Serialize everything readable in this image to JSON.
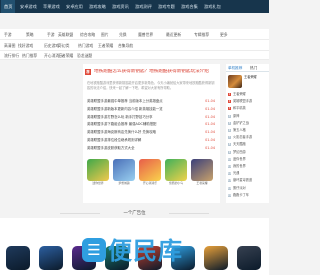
{
  "nav": {
    "items": [
      "首页",
      "安卓游戏",
      "苹果游戏",
      "安卓应用",
      "游戏攻略",
      "游戏资讯",
      "游戏测评",
      "游戏专题",
      "游戏合集",
      "游戏礼包"
    ],
    "active_index": 0
  },
  "categories": {
    "row1": [
      "手游",
      "策略",
      "手游",
      "英雄联盟",
      "综合攻略",
      "图片",
      "兑换",
      "魔兽世界",
      "最近更新",
      "专辑推荐",
      "更多"
    ],
    "row2": [
      "高清图",
      "找好游戏",
      "历史游戏",
      "奇幻类",
      "热门游戏",
      "王者荣耀",
      "合集导航"
    ],
    "row3": [
      "流行排行",
      "热门推荐",
      "开心消消乐",
      "王者荣耀",
      "恐龙谜题"
    ]
  },
  "headline": {
    "badge": "荐",
    "title": "地铁跑酷怎么获得新钥匙？地铁跑酷获得新钥匙玩法介绍",
    "intro": "在地铁跑酷游戏里获得新钥匙能开启更多新角色，今天小编就给大家带来地铁跑酷获得新钥匙的玩法介绍，快来一起了解一下吧，希望对大家有所帮助。"
  },
  "news": [
    {
      "title": "英雄联盟手游最强中单推荐 当前版本上分英雄盘点",
      "date": "01-04"
    },
    {
      "title": "英雄联盟手游新版本更新内容介绍 新英雄技能一览",
      "date": "01-04"
    },
    {
      "title": "英雄联盟手游打野怎么玩 新手打野技巧分享",
      "date": "01-04"
    },
    {
      "title": "英雄联盟手游下路组合推荐 最强ADC辅助搭配",
      "date": "01-04"
    },
    {
      "title": "英雄联盟手游海克斯商店兑换什么好 兑换攻略",
      "date": "01-04"
    },
    {
      "title": "英雄联盟手游排位段位继承规则详解",
      "date": "01-04"
    },
    {
      "title": "英雄联盟手游皮肤获取方式大全",
      "date": "01-04"
    }
  ],
  "games": [
    {
      "name": "迷你世界",
      "color1": "#3fa84a",
      "color2": "#f2c94c"
    },
    {
      "name": "梦想城镇",
      "color1": "#4a6fb8",
      "color2": "#9ad0f0"
    },
    {
      "name": "开心消消乐",
      "color1": "#e85d4a",
      "color2": "#f9d34c"
    },
    {
      "name": "愤怒的小鸟",
      "color1": "#3fb05a",
      "color2": "#f0d24a"
    },
    {
      "name": "王者荣耀",
      "color1": "#3a3f7a",
      "color2": "#c9a26b"
    }
  ],
  "side": {
    "tabs": [
      "单机推荐",
      "热门"
    ],
    "active_tab": 0,
    "featured": "王者荣耀",
    "ranks": [
      "王者荣耀",
      "英雄联盟手游",
      "和平精英",
      "原神",
      "金铲铲之战",
      "第五人格",
      "火影忍者手游",
      "天天酷跑",
      "梦幻西游",
      "迷你世界",
      "我的世界",
      "光遇",
      "崩坏星穹铁道",
      "蛋仔派对",
      "跑跑卡丁车"
    ]
  },
  "bottom": {
    "section_title": "一个广告位",
    "tiles": [
      "#1f3a5c",
      "#2c5fa0",
      "#5a2a8f",
      "#1a7a6a",
      "#c7402f",
      "#2f9ee0",
      "#e7a03a",
      "#374151"
    ]
  },
  "watermark": {
    "logo": "☰",
    "text": "便民库"
  }
}
